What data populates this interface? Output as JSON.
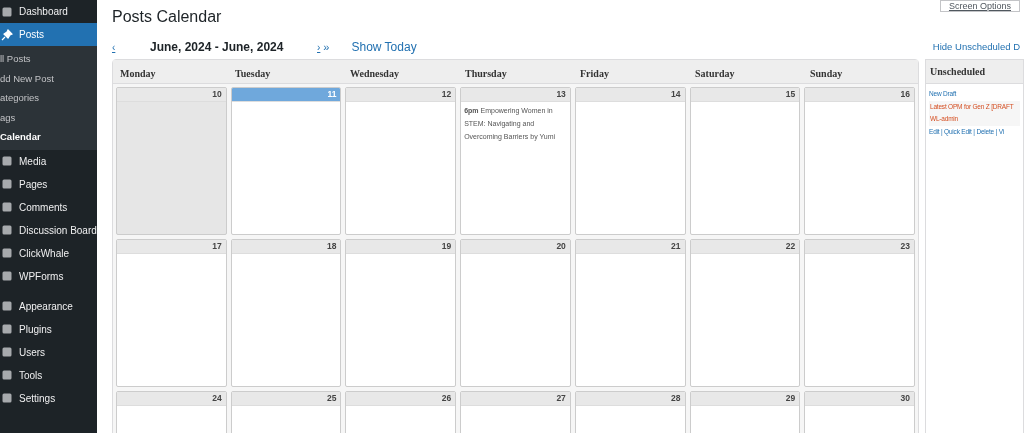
{
  "sidebar": {
    "groups": [
      [
        {
          "label": "Dashboard",
          "kind": "menu",
          "selected": false
        },
        {
          "label": "Posts",
          "kind": "posts",
          "selected": true,
          "children": [
            {
              "label": "ll Posts",
              "selected": false
            },
            {
              "label": "dd New Post",
              "selected": false
            },
            {
              "label": "ategories",
              "selected": false
            },
            {
              "label": "ags",
              "selected": false
            },
            {
              "label": "Calendar",
              "selected": true
            }
          ]
        },
        {
          "label": "Media",
          "kind": "menu",
          "selected": false
        },
        {
          "label": "Pages",
          "kind": "menu",
          "selected": false
        },
        {
          "label": "Comments",
          "kind": "menu",
          "selected": false
        },
        {
          "label": "Discussion Board",
          "kind": "menu",
          "selected": false
        },
        {
          "label": "ClickWhale",
          "kind": "menu",
          "selected": false
        },
        {
          "label": "WPForms",
          "kind": "menu",
          "selected": false
        }
      ],
      [
        {
          "label": "Appearance",
          "kind": "menu",
          "selected": false
        },
        {
          "label": "Plugins",
          "kind": "menu",
          "selected": false
        },
        {
          "label": "Users",
          "kind": "menu",
          "selected": false
        },
        {
          "label": "Tools",
          "kind": "menu",
          "selected": false
        },
        {
          "label": "Settings",
          "kind": "menu",
          "selected": false
        }
      ]
    ]
  },
  "screen_options": "Screen Options",
  "page_title": "Posts Calendar",
  "nav": {
    "prev": "‹",
    "range": "June, 2024 - June, 2024",
    "next": "›",
    "next_fast": "»",
    "show_today": "Show Today",
    "hide_unscheduled": "Hide Unscheduled D"
  },
  "calendar": {
    "days": [
      "Monday",
      "Tuesday",
      "Wednesday",
      "Thursday",
      "Friday",
      "Saturday",
      "Sunday"
    ],
    "weeks": [
      [
        {
          "date": "10",
          "today": false,
          "past": true
        },
        {
          "date": "11",
          "today": true,
          "past": false
        },
        {
          "date": "12",
          "today": false,
          "past": false
        },
        {
          "date": "13",
          "today": false,
          "past": false,
          "events": [
            "**6pm** Empowering Women in STEM: Navigating and Overcoming Barriers  by Yumi"
          ]
        },
        {
          "date": "14",
          "today": false,
          "past": false
        },
        {
          "date": "15",
          "today": false,
          "past": false
        },
        {
          "date": "16",
          "today": false,
          "past": false
        }
      ],
      [
        {
          "date": "17",
          "today": false,
          "past": false
        },
        {
          "date": "18",
          "today": false,
          "past": false
        },
        {
          "date": "19",
          "today": false,
          "past": false
        },
        {
          "date": "20",
          "today": false,
          "past": false
        },
        {
          "date": "21",
          "today": false,
          "past": false
        },
        {
          "date": "22",
          "today": false,
          "past": false
        },
        {
          "date": "23",
          "today": false,
          "past": false
        }
      ],
      [
        {
          "date": "24",
          "today": false,
          "past": false
        },
        {
          "date": "25",
          "today": false,
          "past": false
        },
        {
          "date": "26",
          "today": false,
          "past": false
        },
        {
          "date": "27",
          "today": false,
          "past": false
        },
        {
          "date": "28",
          "today": false,
          "past": false
        },
        {
          "date": "29",
          "today": false,
          "past": false
        },
        {
          "date": "30",
          "today": false,
          "past": false
        }
      ]
    ]
  },
  "unscheduled": {
    "title": "Unscheduled",
    "new_draft": "New Draft",
    "drafts": [
      {
        "title": "Latest OPM for Gen Z [DRAFT",
        "author": "WL-admin",
        "actions": "Edit | Quick Edit | Delete | Vi"
      }
    ]
  }
}
